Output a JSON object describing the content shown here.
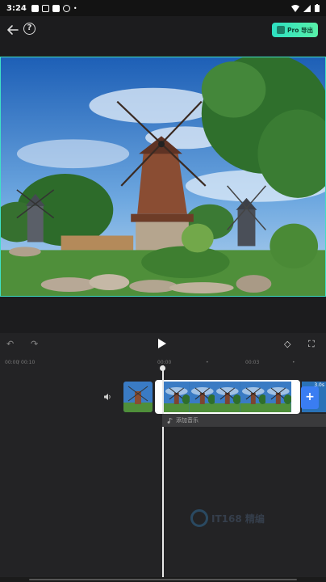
{
  "status_bar": {
    "time": "3:24",
    "icons": [
      "notification-icon",
      "download-icon",
      "app-icon",
      "game-icon"
    ],
    "right_icons": [
      "wifi-icon",
      "signal-icon",
      "battery-icon"
    ]
  },
  "header": {
    "export_label": "Pro 导出",
    "help_glyph": "?"
  },
  "timeline": {
    "time_current": "00:00",
    "time_total": "00:10",
    "ruler_marks": [
      "00:00",
      "00:03"
    ],
    "clip_duration": "3.0s",
    "music_label": "添加音乐"
  },
  "controls": {
    "undo_glyph": "↶",
    "redo_glyph": "↷",
    "keyframe_glyph": "◇",
    "fullscreen_glyph": "⛶"
  },
  "watermark": {
    "text": "IT168 精编"
  },
  "colors": {
    "accent": "#3fe0c6",
    "add_button": "#3a7df2",
    "background": "#232325"
  }
}
